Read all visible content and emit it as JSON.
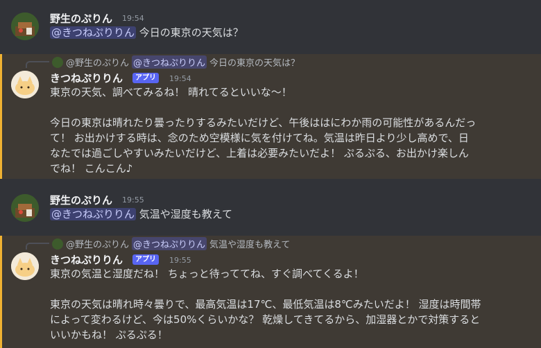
{
  "messages": [
    {
      "username": "野生のぷりん",
      "time": "19:54",
      "mention": "@きつねぷりりん",
      "text": "今日の東京の天気は？"
    },
    {
      "reply": {
        "user": "@野生のぷりん",
        "mention": "@きつねぷりりん",
        "text": "今日の東京の天気は？"
      },
      "username": "きつねぷりりん",
      "badge": "アプリ",
      "time": "19:54",
      "lines": [
        "東京の天気、調べてみるね！ 晴れてるといいな〜！",
        "",
        " 今日の東京は晴れたり曇ったりするみたいだけど、午後ははにわか雨の可能性があるんだっ",
        "て！ お出かけする時は、念のため空模様に気を付けてね。気温は昨日より少し高めで、日",
        "なたでは過ごしやすいみたいだけど、上着は必要みたいだよ！ ぷるぷる、お出かけ楽しん",
        "でね！ こんこん♪"
      ]
    },
    {
      "username": "野生のぷりん",
      "time": "19:55",
      "mention": "@きつねぷりりん",
      "text": "気温や湿度も教えて"
    },
    {
      "reply": {
        "user": "@野生のぷりん",
        "mention": "@きつねぷりりん",
        "text": "気温や湿度も教えて"
      },
      "username": "きつねぷりりん",
      "badge": "アプリ",
      "time": "19:55",
      "lines": [
        "東京の気温と湿度だね！ ちょっと待っててね、すぐ調べてくるよ！",
        "",
        "東京の天気は晴れ時々曇りで、最高気温は17℃、最低気温は8℃みたいだよ！ 湿度は時間帯",
        "によって変わるけど、今は50%くらいかな？ 乾燥してきてるから、加湿器とかで対策すると",
        "いいかもね！ ぷるぷる！"
      ]
    }
  ],
  "colors": {
    "background": "#313338",
    "highlight": "#3f3a34",
    "highlight_border": "#f0b232",
    "badge": "#5865f2",
    "mention_bg": "rgba(88,101,242,0.3)"
  }
}
